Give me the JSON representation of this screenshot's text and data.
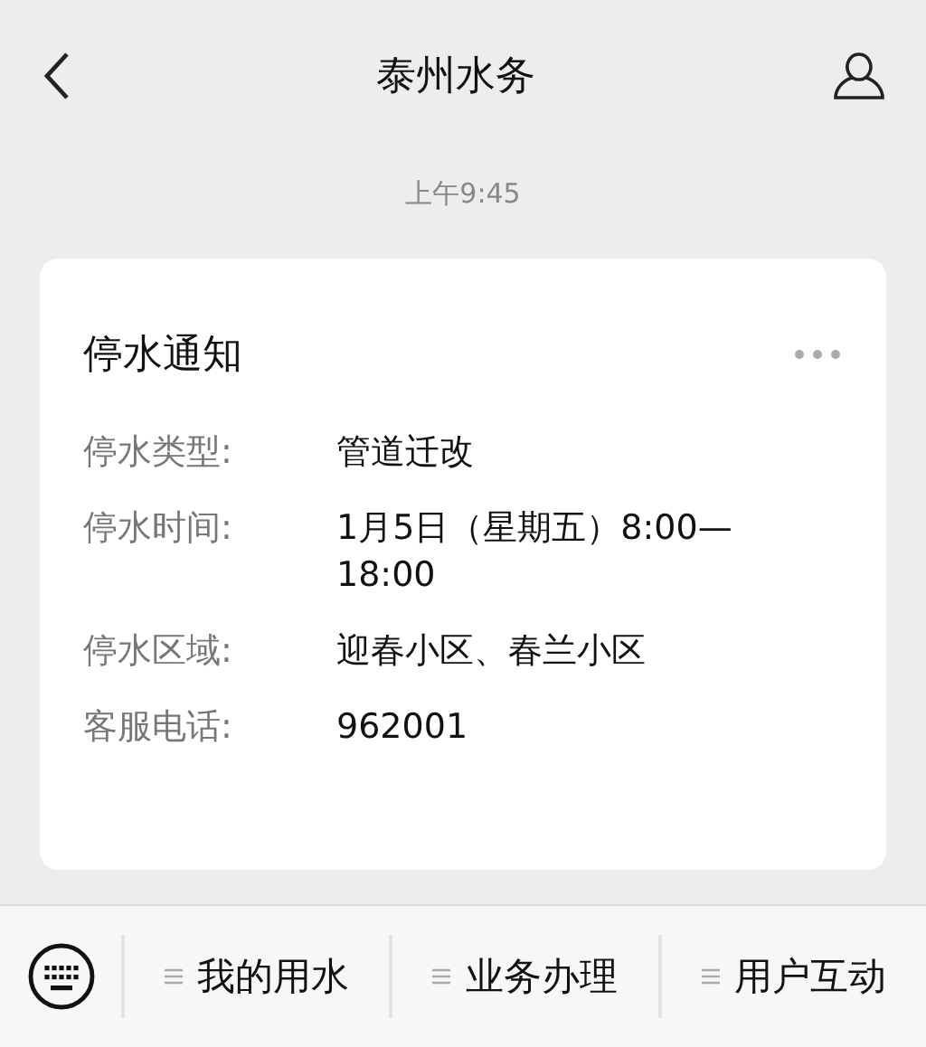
{
  "header": {
    "title": "泰州水务"
  },
  "timestamp": "上午9:45",
  "card": {
    "title": "停水通知",
    "fields": [
      {
        "label": "停水类型:",
        "value": "管道迁改"
      },
      {
        "label": "停水时间:",
        "value": "1月5日（星期五）8:00—18:00"
      },
      {
        "label": "停水区域:",
        "value": "迎春小区、春兰小区"
      },
      {
        "label": "客服电话:",
        "value": "962001"
      }
    ]
  },
  "menu": [
    {
      "label": "我的用水"
    },
    {
      "label": "业务办理"
    },
    {
      "label": "用户互动"
    }
  ]
}
